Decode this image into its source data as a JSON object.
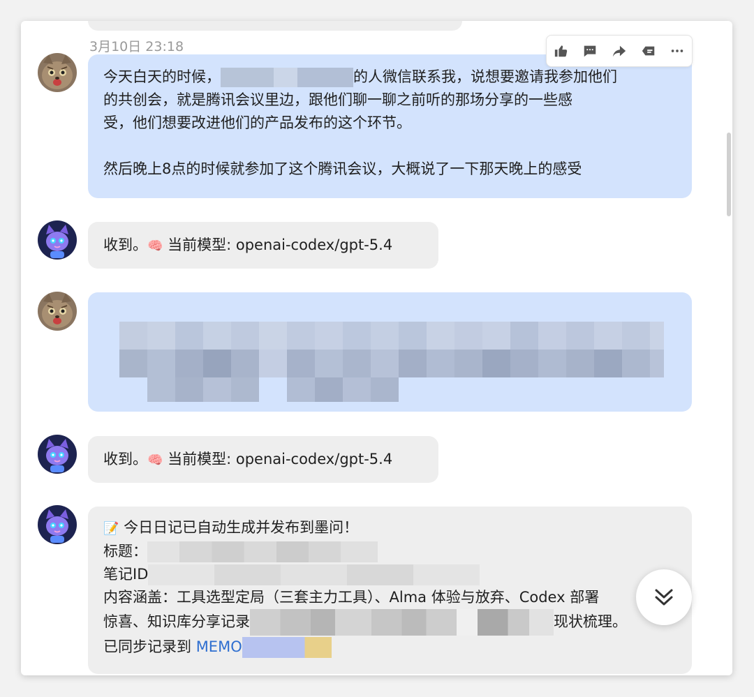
{
  "conversation": {
    "timestamp": "3月10日 23:18",
    "toolbar": [
      "thumbs-up-icon",
      "comment-icon",
      "forward-icon",
      "quote-icon",
      "more-icon"
    ],
    "messages": [
      {
        "role": "user",
        "lines": {
          "l1_pre": "今天白天的时候，",
          "l1_post": "的人微信联系我，说想要邀请我参加他们",
          "l2": "的共创会，就是腾讯会议里边，跟他们聊一聊之前听的那场分享的一些感",
          "l3": "受，他们想要改进他们的产品发布的这个环节。",
          "l4": "然后晚上8点的时候就参加了这个腾讯会议，大概说了一下那天晚上的感受"
        }
      },
      {
        "role": "bot",
        "text_pre": "收到。",
        "emoji": "🧠",
        "text_post": " 当前模型: openai-codex/gpt-5.4"
      },
      {
        "role": "user",
        "redacted": true
      },
      {
        "role": "bot",
        "text_pre": "收到。",
        "emoji": "🧠",
        "text_post": " 当前模型: openai-codex/gpt-5.4"
      },
      {
        "role": "bot",
        "diary": {
          "emoji": "📝",
          "headline": " 今日日记已自动生成并发布到墨问！",
          "title_label": "标题：",
          "noteid_label": "笔记ID",
          "content_prefix": "内容涵盖：工具选型定局（三套主力工具）、Alma 体验与放弃、Codex 部署",
          "content_line2_pre": "惊喜、知识库分享记录",
          "content_line2_post": "现状梳理。",
          "sync_pre": "已同步记录到 ",
          "sync_link": "MEMO"
        }
      }
    ]
  },
  "colors": {
    "user_bubble": "#d3e3fd",
    "bot_bubble": "#eeeeee",
    "link": "#2f6fd0"
  }
}
